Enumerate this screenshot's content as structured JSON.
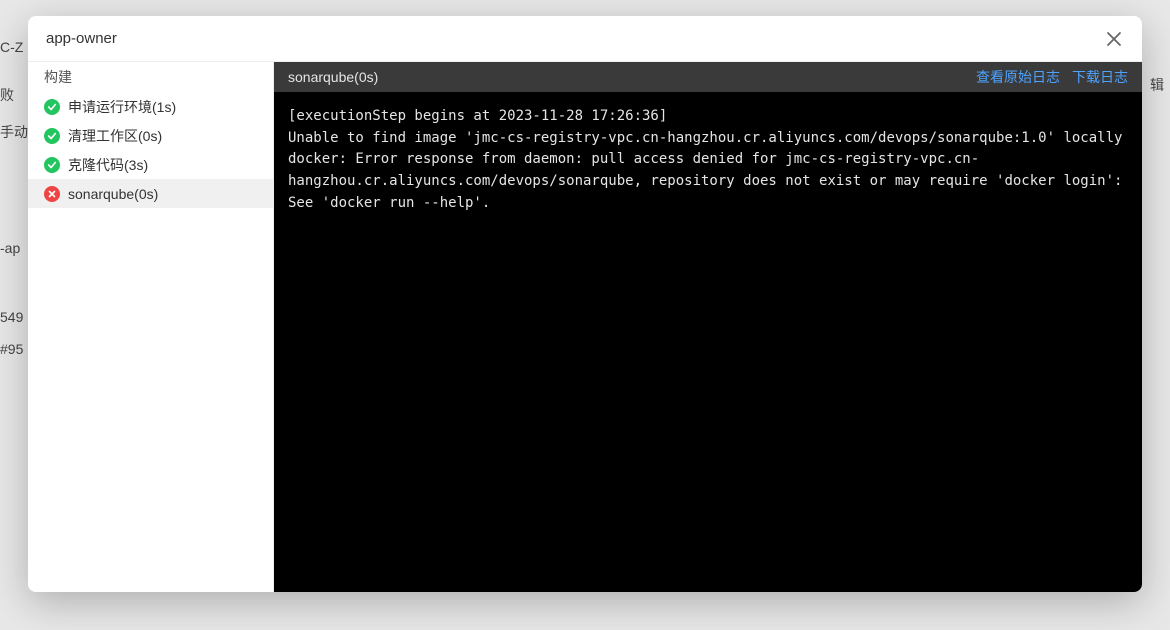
{
  "bg": {
    "frag1": "C-Z",
    "frag2": "败",
    "frag3": "手动",
    "frag4": "-ap",
    "frag5": "549",
    "frag6": "#95",
    "frag7": "辑"
  },
  "modal": {
    "title": "app-owner"
  },
  "sidebar": {
    "header": "构建",
    "steps": [
      {
        "label": "申请运行环境(1s)",
        "status": "success"
      },
      {
        "label": "清理工作区(0s)",
        "status": "success"
      },
      {
        "label": "克隆代码(3s)",
        "status": "success"
      },
      {
        "label": "sonarqube(0s)",
        "status": "error",
        "active": true
      }
    ]
  },
  "content": {
    "header_title": "sonarqube(0s)",
    "view_raw": "查看原始日志",
    "download": "下载日志",
    "log": "[executionStep begins at 2023-11-28 17:26:36]\nUnable to find image 'jmc-cs-registry-vpc.cn-hangzhou.cr.aliyuncs.com/devops/sonarqube:1.0' locally\ndocker: Error response from daemon: pull access denied for jmc-cs-registry-vpc.cn-hangzhou.cr.aliyuncs.com/devops/sonarqube, repository does not exist or may require 'docker login':\nSee 'docker run --help'."
  }
}
